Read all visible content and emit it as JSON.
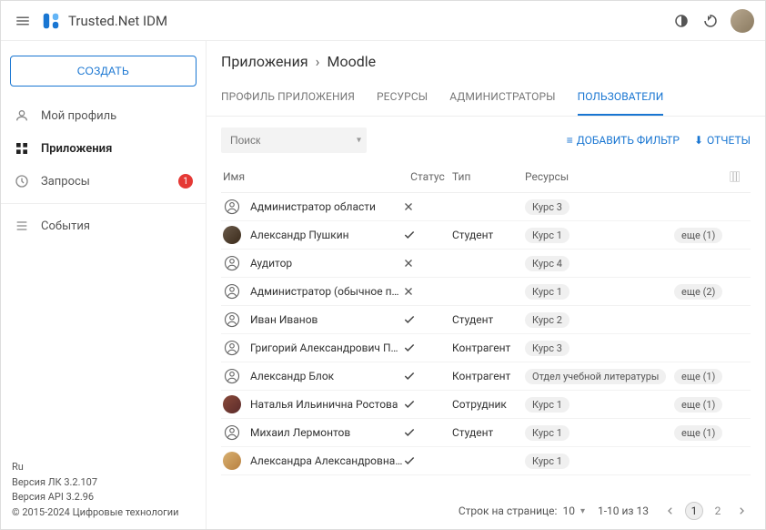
{
  "header": {
    "app_title": "Trusted.Net IDM"
  },
  "sidebar": {
    "create_label": "СОЗДАТЬ",
    "items": [
      {
        "label": "Мой профиль",
        "icon": "user-icon"
      },
      {
        "label": "Приложения",
        "icon": "apps-icon",
        "active": true
      },
      {
        "label": "Запросы",
        "icon": "history-icon",
        "badge": "1"
      }
    ],
    "events_label": "События"
  },
  "footer": {
    "lang": "Ru",
    "version_lk": "Версия ЛК 3.2.107",
    "version_api": "Версия API 3.2.96",
    "copyright": "© 2015-2024 Цифровые технологии"
  },
  "breadcrumb": {
    "root": "Приложения",
    "sep": "›",
    "current": "Moodle"
  },
  "tabs": [
    {
      "label": "ПРОФИЛЬ ПРИЛОЖЕНИЯ"
    },
    {
      "label": "РЕСУРСЫ"
    },
    {
      "label": "АДМИНИСТРАТОРЫ"
    },
    {
      "label": "ПОЛЬЗОВАТЕЛИ",
      "active": true
    }
  ],
  "toolbar": {
    "search_placeholder": "Поиск",
    "add_filter": "ДОБАВИТЬ ФИЛЬТР",
    "reports": "ОТЧЕТЫ"
  },
  "table": {
    "columns": {
      "name": "Имя",
      "status": "Статус",
      "type": "Тип",
      "resources": "Ресурсы"
    },
    "rows": [
      {
        "avatar": "generic",
        "name": "Администратор области",
        "status": "x",
        "type": "",
        "resource": "Курс 3",
        "more": ""
      },
      {
        "avatar": "photo1",
        "name": "Александр Пушкин",
        "status": "check",
        "type": "Студент",
        "resource": "Курс 1",
        "more": "еще (1)"
      },
      {
        "avatar": "generic",
        "name": "Аудитор",
        "status": "x",
        "type": "",
        "resource": "Курс 4",
        "more": ""
      },
      {
        "avatar": "generic",
        "name": "Администратор (обычное приложе...",
        "status": "x",
        "type": "",
        "resource": "Курс 1",
        "more": "еще (2)"
      },
      {
        "avatar": "generic",
        "name": "Иван Иванов",
        "status": "check",
        "type": "Студент",
        "resource": "Курс 2",
        "more": ""
      },
      {
        "avatar": "generic",
        "name": "Григорий Александрович Печорин",
        "status": "check",
        "type": "Контрагент",
        "resource": "Курс 3",
        "more": ""
      },
      {
        "avatar": "generic",
        "name": "Александр Блок",
        "status": "check",
        "type": "Контрагент",
        "resource": "Отдел учебной литературы",
        "more": "еще (1)"
      },
      {
        "avatar": "photo2",
        "name": "Наталья Ильинична Ростова",
        "status": "check",
        "type": "Сотрудник",
        "resource": "Курс 1",
        "more": "еще (1)"
      },
      {
        "avatar": "generic",
        "name": "Михаил Лермонтов",
        "status": "check",
        "type": "Студент",
        "resource": "Курс 1",
        "more": "еще (1)"
      },
      {
        "avatar": "photo3",
        "name": "Александра Александровна Алекс...",
        "status": "check",
        "type": "",
        "resource": "Курс 1",
        "more": ""
      }
    ]
  },
  "pager": {
    "rows_label": "Строк на странице:",
    "page_size": "10",
    "range": "1-10 из 13",
    "pages": [
      "1",
      "2"
    ]
  }
}
